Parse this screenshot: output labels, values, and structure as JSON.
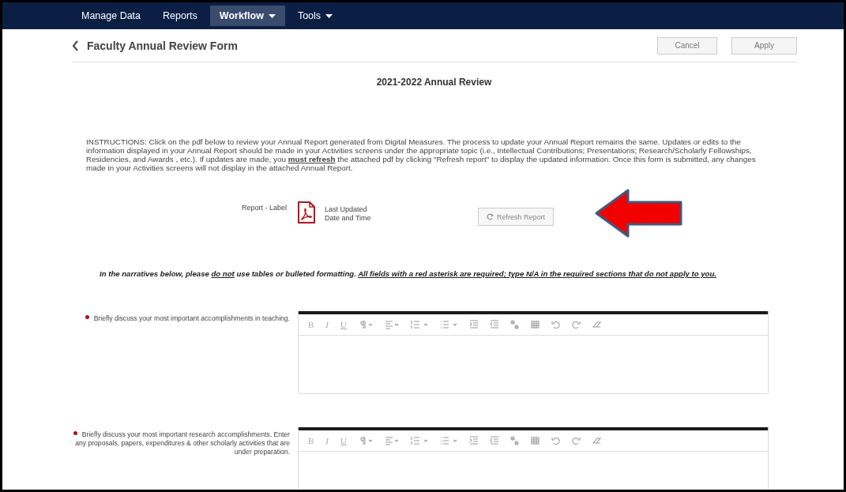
{
  "nav": {
    "items": [
      {
        "label": "Manage Data",
        "selected": false,
        "has_menu": false
      },
      {
        "label": "Reports",
        "selected": false,
        "has_menu": false
      },
      {
        "label": "Workflow",
        "selected": true,
        "has_menu": true
      },
      {
        "label": "Tools",
        "selected": false,
        "has_menu": true
      }
    ]
  },
  "header": {
    "title": "Faculty Annual Review Form",
    "buttons": [
      "Cancel",
      "Apply"
    ]
  },
  "form": {
    "heading": "2021-2022 Annual Review",
    "instructions": "INSTRUCTIONS:  Click on the pdf below to review your Annual Report generated from Digital Measures. The process to update your Annual Report remains the same.  Updates or edits to the information displayed in your Annual Report should be made in your Activities screens under the appropriate topic (i.e., Intellectual Contributions; Presentations; Research/Scholarly Fellowships, Residencies, and Awards , etc.). If updates are made, you **must refresh** the attached pdf by clicking \"Refresh report\" to display the updated information. Once this form is submitted, any changes made in your Activities screens will not display in the attached Annual Report.",
    "report": {
      "label": "Report - Label",
      "updated": "Last Updated Date and Time",
      "refresh_button": "Refresh Report"
    },
    "notice": [
      {
        "text": "In the narratives below, please ",
        "underlined": false
      },
      {
        "text": "do not",
        "underlined": true
      },
      {
        "text": " use tables or bulleted formatting. ",
        "underlined": false
      },
      {
        "text": "All fields with a red asterisk are required; type N/A in the required sections that do not apply to you.",
        "underlined": true
      }
    ],
    "editors": [
      {
        "label": "Briefly discuss your most important accomplishments in teaching.",
        "required": true,
        "toolbar_letters": [
          "B",
          "I",
          "U"
        ]
      },
      {
        "label": "Briefly discuss your most important research accomplishments. Enter any proposals, papers, expenditures & other scholarly activities that are under preparation.",
        "required": true,
        "toolbar_letters": [
          "B",
          "I",
          "U"
        ]
      }
    ]
  }
}
